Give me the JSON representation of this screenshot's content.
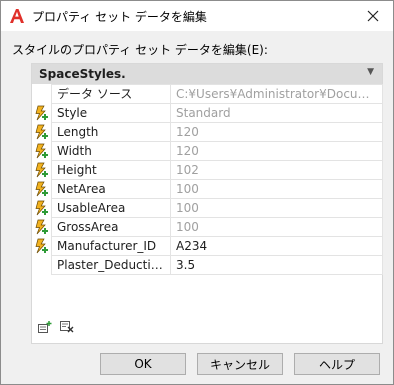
{
  "window": {
    "title": "プロパティ セット データを編集",
    "prompt": "スタイルのプロパティ セット データを編集(E):"
  },
  "group": {
    "name": "SpaceStyles."
  },
  "properties": [
    {
      "name": "データ ソース",
      "value": "C:¥Users¥Administrator¥Document..."
    },
    {
      "name": "Style",
      "value": "Standard"
    },
    {
      "name": "Length",
      "value": "120"
    },
    {
      "name": "Width",
      "value": "120"
    },
    {
      "name": "Height",
      "value": "102"
    },
    {
      "name": "NetArea",
      "value": "100"
    },
    {
      "name": "UsableArea",
      "value": "100"
    },
    {
      "name": "GrossArea",
      "value": "100"
    },
    {
      "name": "Manufacturer_ID",
      "value": "A234"
    },
    {
      "name": "Plaster_Deduction",
      "value": "3.5"
    }
  ],
  "buttons": {
    "ok": "OK",
    "cancel": "キャンセル",
    "help": "ヘルプ"
  },
  "icons": {
    "app": "autocad-a-icon",
    "close": "close-icon",
    "row": "automatic-property-lightning-icon",
    "add": "add-property-sets-icon",
    "remove": "remove-property-sets-icon"
  },
  "colors": {
    "accent_red": "#e0302a",
    "lightning_yellow": "#f2b21f",
    "plus_green": "#2e9b37",
    "disabled_text": "#a0a0a0"
  }
}
